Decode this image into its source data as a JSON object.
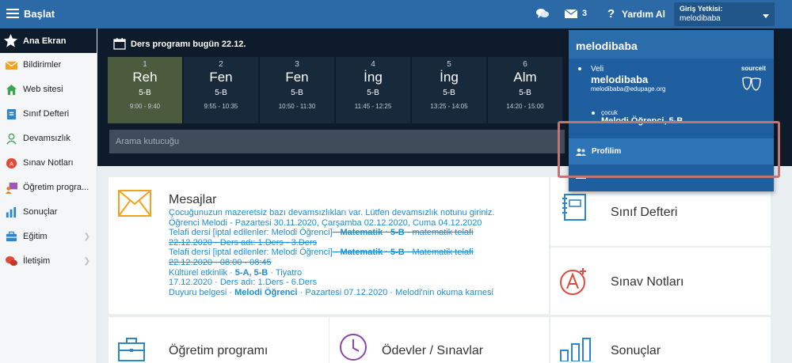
{
  "topbar": {
    "menu_label": "Başlat",
    "messages_count": "3",
    "help_label": "Yardım Al",
    "login_title": "Giriş Yetkisi:",
    "login_user": "melodibaba",
    "help_icon": "?"
  },
  "sidebar": {
    "items": [
      {
        "label": "Ana Ekran",
        "icon": "star-icon"
      },
      {
        "label": "Bildirimler",
        "icon": "mail-icon"
      },
      {
        "label": "Web sitesi",
        "icon": "home-icon"
      },
      {
        "label": "Sınıf Defteri",
        "icon": "book-icon"
      },
      {
        "label": "Devamsızlık",
        "icon": "person-icon"
      },
      {
        "label": "Sınav Notları",
        "icon": "grade-icon"
      },
      {
        "label": "Öğretim progra...",
        "icon": "teacher-icon"
      },
      {
        "label": "Sonuçlar",
        "icon": "chart-icon"
      },
      {
        "label": "Eğitim",
        "icon": "briefcase-icon"
      },
      {
        "label": "İletişim",
        "icon": "chat-icon"
      }
    ]
  },
  "schedule": {
    "title": "Ders programı bugün 22.12.",
    "search_placeholder": "Arama kutucuğu",
    "lessons": [
      {
        "num": "1",
        "subject": "Reh",
        "class": "5-B",
        "time": "9:00 - 9:40"
      },
      {
        "num": "2",
        "subject": "Fen",
        "class": "5-B",
        "time": "9:55 - 10:35"
      },
      {
        "num": "3",
        "subject": "Fen",
        "class": "5-B",
        "time": "10:50 - 11:30"
      },
      {
        "num": "4",
        "subject": "İng",
        "class": "5-B",
        "time": "11:45 - 12:25"
      },
      {
        "num": "5",
        "subject": "İng",
        "class": "5-B",
        "time": "13:25 - 14:05"
      },
      {
        "num": "6",
        "subject": "Alm",
        "class": "5-B",
        "time": "14:20 - 15:00"
      }
    ]
  },
  "messages": {
    "title": "Mesajlar",
    "m1": "Çocuğunuzun mazeretsiz bazı devamsızlıkları var. Lütfen devamsızlık notunu giriniz.",
    "m1b": "Öğrenci Melodi - Pazartesi 30.11.2020, Çarşamba 02.12.2020, Cuma 04.12.2020",
    "m2a": "Telafi dersi [iptal edilenler: Melodi Öğrenci]",
    "m2b": "Matematik · 5-B",
    "m2c": " · matematik telafi",
    "m2d": "22.12.2020 · Ders adı: 1.Ders - 3.Ders",
    "m3a": "Telafi dersi [iptal edilenler: Melodi Öğrenci]",
    "m3b": "Matematik · 5-B",
    "m3c": " · Matematik telafi",
    "m3d": "22.12.2020 · 08:00 - 08:45",
    "m4a": "Kültürel etkinlik · ",
    "m4b": "5-A, 5-B",
    "m4c": " · Tiyatro",
    "m4d": "17.12.2020 · Ders adı: 1.Ders - 6.Ders",
    "m5a": "Duyuru belgesi · ",
    "m5b": "Melodi Öğrenci",
    "m5c": " · Pazartesi 07.12.2020 · Melodi'nin okuma karnesi"
  },
  "cards": {
    "class_book": "Sınıf Defteri",
    "exam_grades": "Sınav Notları",
    "curriculum": "Öğretim programı",
    "homework": "Ödevler / Sınavlar",
    "results": "Sonuçlar"
  },
  "dropdown": {
    "header_name": "melodibaba",
    "parent_role": "Veli",
    "parent_name": "melodibaba",
    "parent_email": "melodibaba@edupage.org",
    "source_label": "sourceit",
    "child_role": "çocuk",
    "child_name": "Melodi Öğrenci, 5-B",
    "profile_label": "Profilim"
  },
  "colors": {
    "topbar": "#2c6aa7",
    "schedule_bg": "#0e1b2a",
    "accent_orange": "#f4a21d",
    "link_blue": "#1a8ed8",
    "highlight": "#c47375"
  }
}
